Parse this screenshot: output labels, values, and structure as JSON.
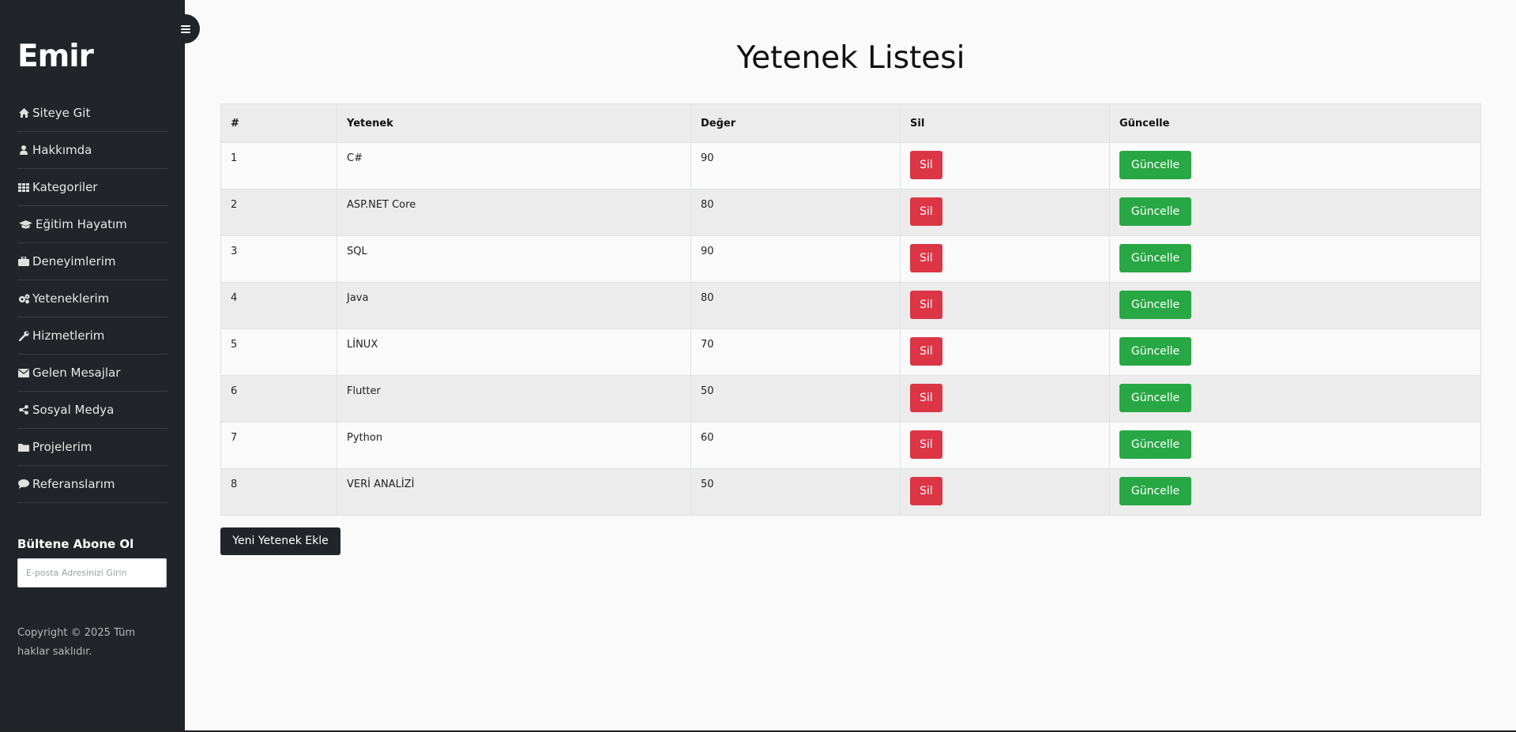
{
  "sidebar": {
    "brand": "Emir",
    "items": [
      {
        "label": "Siteye Git",
        "icon": "home-icon"
      },
      {
        "label": "Hakkımda",
        "icon": "user-icon"
      },
      {
        "label": "Kategoriler",
        "icon": "grid-icon"
      },
      {
        "label": "Eğitim Hayatım",
        "icon": "graduation-cap-icon"
      },
      {
        "label": "Deneyimlerim",
        "icon": "briefcase-icon"
      },
      {
        "label": "Yeteneklerim",
        "icon": "gears-icon"
      },
      {
        "label": "Hizmetlerim",
        "icon": "wrench-icon"
      },
      {
        "label": "Gelen Mesajlar",
        "icon": "envelope-icon"
      },
      {
        "label": "Sosyal Medya",
        "icon": "share-icon"
      },
      {
        "label": "Projelerim",
        "icon": "folder-icon"
      },
      {
        "label": "Referanslarım",
        "icon": "comment-icon"
      }
    ],
    "newsletter_title": "Bültene Abone Ol",
    "newsletter_placeholder": "E-posta Adresinizi Girin",
    "copyright": "Copyright © 2025 Tüm haklar saklıdır."
  },
  "main": {
    "title": "Yetenek Listesi",
    "columns": [
      "#",
      "Yetenek",
      "Değer",
      "Sil",
      "Güncelle"
    ],
    "rows": [
      {
        "id": "1",
        "name": "C#",
        "value": "90",
        "delete_label": "Sil",
        "update_label": "Güncelle"
      },
      {
        "id": "2",
        "name": "ASP.NET Core",
        "value": "80",
        "delete_label": "Sil",
        "update_label": "Güncelle"
      },
      {
        "id": "3",
        "name": "SQL",
        "value": "90",
        "delete_label": "Sil",
        "update_label": "Güncelle"
      },
      {
        "id": "4",
        "name": "Java",
        "value": "80",
        "delete_label": "Sil",
        "update_label": "Güncelle"
      },
      {
        "id": "5",
        "name": "LİNUX",
        "value": "70",
        "delete_label": "Sil",
        "update_label": "Güncelle"
      },
      {
        "id": "6",
        "name": "Flutter",
        "value": "50",
        "delete_label": "Sil",
        "update_label": "Güncelle"
      },
      {
        "id": "7",
        "name": "Python",
        "value": "60",
        "delete_label": "Sil",
        "update_label": "Güncelle"
      },
      {
        "id": "8",
        "name": "VERİ ANALİZİ",
        "value": "50",
        "delete_label": "Sil",
        "update_label": "Güncelle"
      }
    ],
    "add_button": "Yeni Yetenek Ekle"
  },
  "colors": {
    "sidebar_bg": "#212529",
    "danger": "#dc3545",
    "success": "#28a745",
    "dark": "#212529"
  }
}
